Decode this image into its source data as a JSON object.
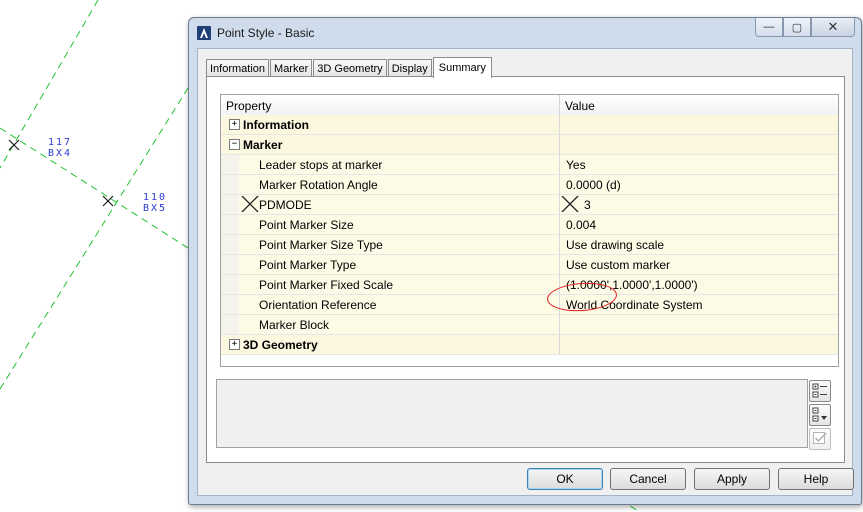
{
  "background": {
    "labels": [
      {
        "number": "117",
        "code": "BX4"
      },
      {
        "number": "110",
        "code": "BX5"
      }
    ],
    "line_color": "#22c22e",
    "label_color": "#2a3bd1"
  },
  "dialog": {
    "title": "Point Style - Basic",
    "window_buttons": {
      "minimize": "—",
      "maximize": "▢",
      "close": "✕"
    },
    "tabs": [
      {
        "label": "Information"
      },
      {
        "label": "Marker"
      },
      {
        "label": "3D Geometry"
      },
      {
        "label": "Display"
      },
      {
        "label": "Summary",
        "active": true
      }
    ],
    "grid": {
      "header": {
        "property": "Property",
        "value": "Value"
      },
      "rows": [
        {
          "type": "category",
          "expander": "+",
          "name": "Information",
          "value": ""
        },
        {
          "type": "category",
          "expander": "−",
          "name": "Marker",
          "value": ""
        },
        {
          "type": "property",
          "name": "Leader stops at marker",
          "value": "Yes"
        },
        {
          "type": "property",
          "name": "Marker Rotation Angle",
          "value": "0.0000 (d)"
        },
        {
          "type": "property",
          "name": "PDMODE",
          "value": "3"
        },
        {
          "type": "property",
          "name": "Point Marker Size",
          "value": "0.004"
        },
        {
          "type": "property",
          "name": "Point Marker Size Type",
          "value": "Use drawing scale"
        },
        {
          "type": "property",
          "name": "Point Marker Type",
          "value": "Use custom marker"
        },
        {
          "type": "property",
          "name": "Point Marker Fixed Scale",
          "value": "(1.0000',1.0000',1.0000')"
        },
        {
          "type": "property",
          "name": "Orientation Reference",
          "value": "World Coordinate System"
        },
        {
          "type": "property",
          "name": "Marker Block",
          "value": ""
        },
        {
          "type": "category",
          "expander": "+",
          "name": "3D Geometry",
          "value": ""
        }
      ],
      "row_background": "#fdfbe6",
      "annotation_color": "#e02020"
    },
    "buttons": {
      "ok": "OK",
      "cancel": "Cancel",
      "apply": "Apply",
      "help": "Help"
    }
  }
}
